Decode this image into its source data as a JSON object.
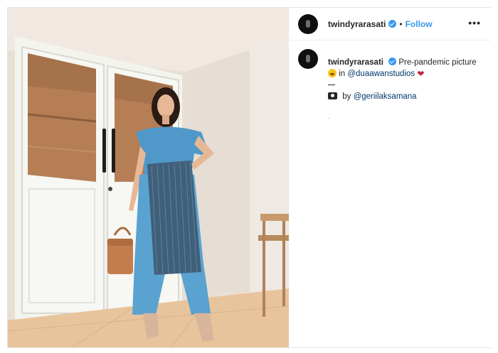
{
  "post": {
    "username": "twindyrarasati",
    "dot": "•",
    "follow_label": "Follow",
    "more_label": "•••"
  },
  "caption": {
    "username": "twindyrarasati",
    "text_1": "Pre-pandemic picture",
    "text_2": "in",
    "mention_studio": "@duaawanstudios",
    "credit_prefix": "by",
    "mention_photographer": "@geriilaksamana",
    "small_mark": "·"
  },
  "icons": {
    "avatar": "avatar-circle",
    "verified": "verified-badge-icon",
    "more": "more-options-icon",
    "emoji_1": "grinning-face-emoji",
    "emoji_2": "heart-emoji",
    "camera": "camera-icon"
  },
  "colors": {
    "link_blue": "#3897f0",
    "mention": "#00376b",
    "text": "#262626"
  }
}
